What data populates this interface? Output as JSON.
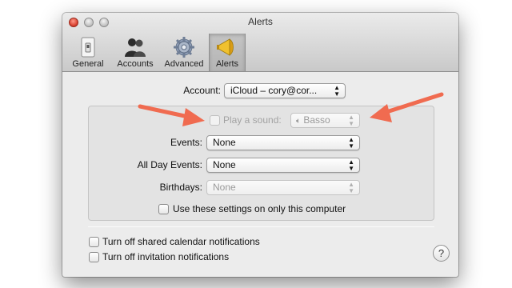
{
  "window": {
    "title": "Alerts"
  },
  "toolbar": {
    "items": [
      {
        "label": "General",
        "icon": "general-switch-icon"
      },
      {
        "label": "Accounts",
        "icon": "accounts-people-icon"
      },
      {
        "label": "Advanced",
        "icon": "advanced-gear-icon"
      },
      {
        "label": "Alerts",
        "icon": "alerts-megaphone-icon",
        "selected": true
      }
    ]
  },
  "account": {
    "label": "Account:",
    "value": "iCloud – cory@cor..."
  },
  "play_sound": {
    "label": "Play a sound:",
    "checked": false,
    "enabled": false,
    "sound": "Basso",
    "sound_icon": "speaker-icon"
  },
  "events": {
    "label": "Events:",
    "value": "None"
  },
  "all_day_events": {
    "label": "All Day Events:",
    "value": "None"
  },
  "birthdays": {
    "label": "Birthdays:",
    "value": "None",
    "enabled": false
  },
  "this_computer_only": {
    "label": "Use these settings on only this computer",
    "checked": false
  },
  "shared_calendar": {
    "label": "Turn off shared calendar notifications",
    "checked": false
  },
  "invitations": {
    "label": "Turn off invitation notifications",
    "checked": false
  },
  "help": {
    "label": "?"
  },
  "annotations": {
    "arrow_color": "#f06b50"
  }
}
